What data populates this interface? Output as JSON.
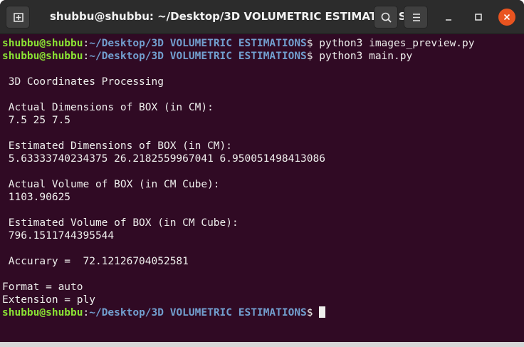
{
  "window": {
    "title": "shubbu@shubbu: ~/Desktop/3D VOLUMETRIC ESTIMATIONS"
  },
  "toolbar": {
    "new_tab_icon": "new-tab-icon",
    "search_icon": "search-icon",
    "menu_icon": "hamburger-menu-icon",
    "minimize_icon": "minimize-icon",
    "maximize_icon": "maximize-icon",
    "close_icon": "close-icon"
  },
  "colors": {
    "background": "#300a24",
    "prompt_user": "#8ae234",
    "prompt_path": "#729fcf",
    "text": "#eeeeec",
    "close_button": "#e95420"
  },
  "terminal": {
    "prompt_user": "shubbu@shubbu",
    "prompt_sep": ":",
    "prompt_path": "~/Desktop/3D VOLUMETRIC ESTIMATIONS",
    "prompt_symbol": "$ ",
    "commands": [
      "python3 images_preview.py",
      "python3 main.py"
    ],
    "output": [
      " 3D Coordinates Processing",
      " Actual Dimensions of BOX (in CM):",
      " 7.5 25 7.5",
      " Estimated Dimensions of BOX (in CM):",
      " 5.63333740234375 26.2182559967041 6.950051498413086",
      " Actual Volume of BOX (in CM Cube):",
      " 1103.90625",
      " Estimated Volume of BOX (in CM Cube):",
      " 796.1511744395544",
      " Accurary =  72.12126704052581",
      "Format = auto",
      "Extension = ply"
    ]
  }
}
